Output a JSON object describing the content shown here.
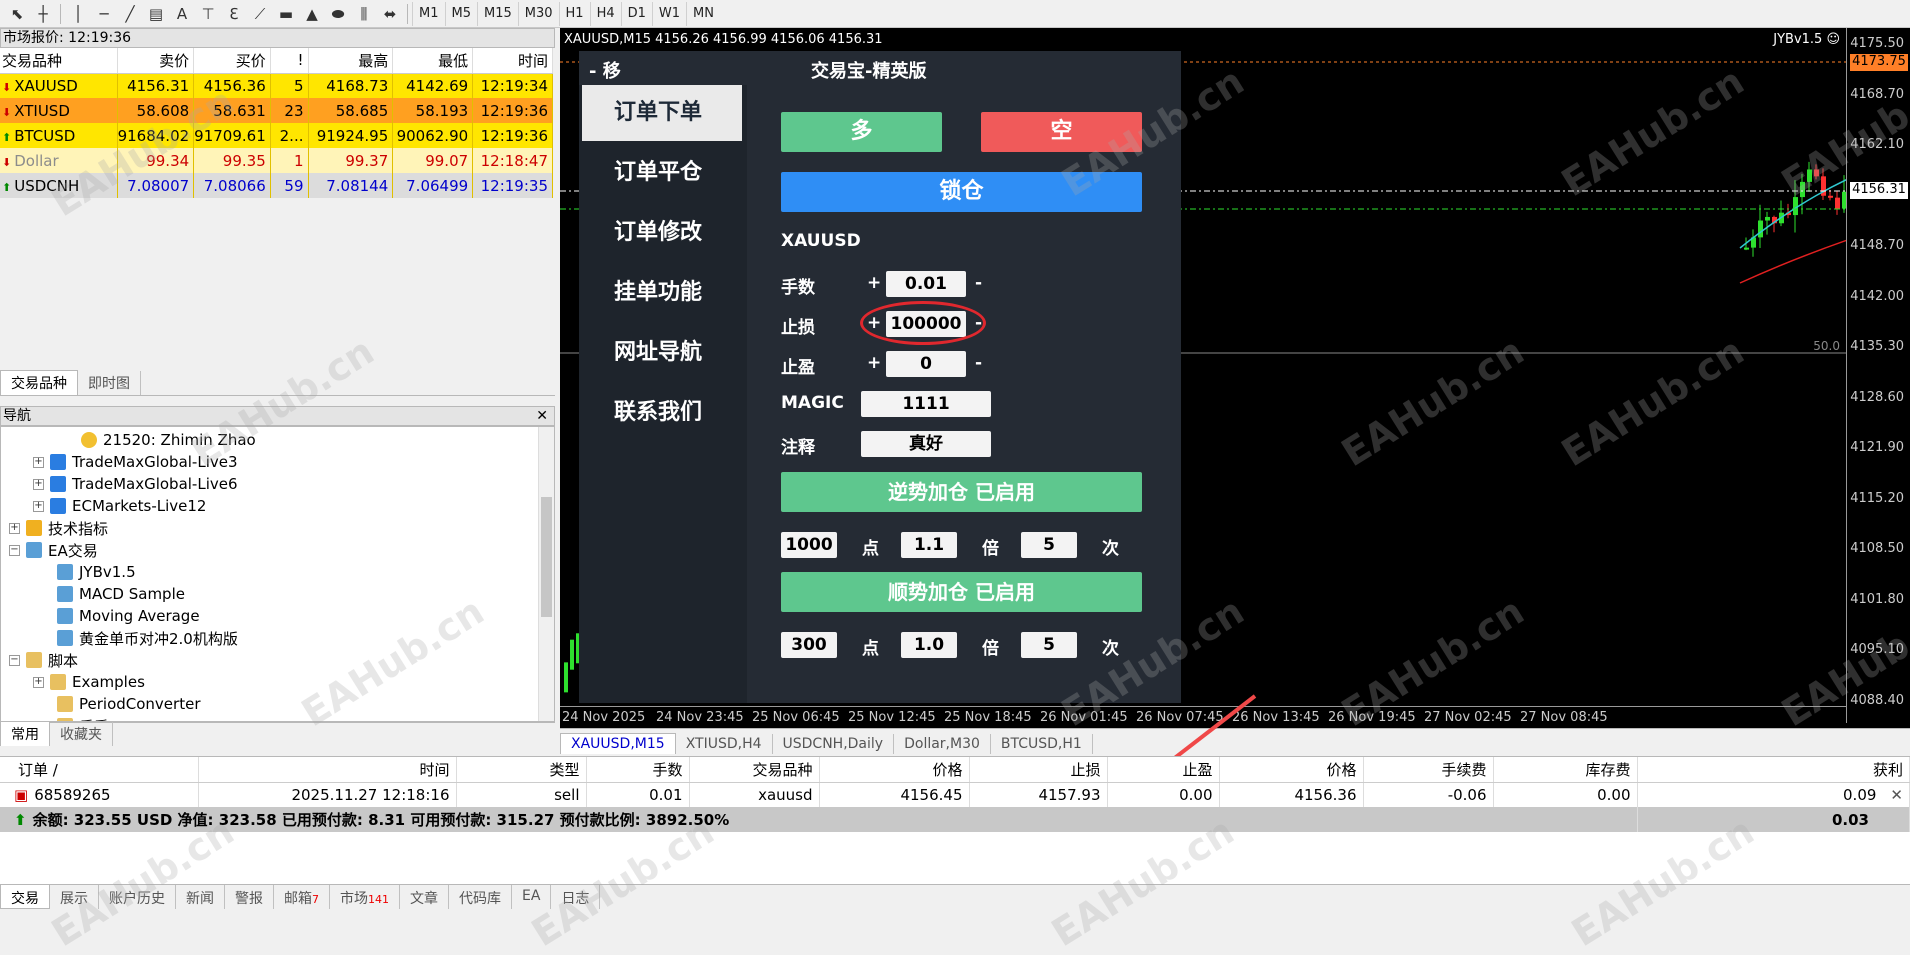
{
  "toolbar": {
    "timeframes": [
      "M1",
      "M5",
      "M15",
      "M30",
      "H1",
      "H4",
      "D1",
      "W1",
      "MN"
    ]
  },
  "market_watch": {
    "title": "市场报价: 12:19:36",
    "columns": [
      "交易品种",
      "卖价",
      "买价",
      "!",
      "最高",
      "最低",
      "时间"
    ],
    "rows": [
      {
        "symbol": "XAUUSD",
        "bid": "4156.31",
        "ask": "4156.36",
        "spread": "5",
        "high": "4168.73",
        "low": "4142.69",
        "time": "12:19:34",
        "bg": "#ffe600",
        "trend": "down"
      },
      {
        "symbol": "XTIUSD",
        "bid": "58.608",
        "ask": "58.631",
        "spread": "23",
        "high": "58.685",
        "low": "58.193",
        "time": "12:19:36",
        "bg": "#ffa020",
        "trend": "down"
      },
      {
        "symbol": "BTCUSD",
        "bid": "91684.02",
        "ask": "91709.61",
        "spread": "2...",
        "high": "91924.95",
        "low": "90062.90",
        "time": "12:19:36",
        "bg": "#ffe600",
        "trend": "up"
      },
      {
        "symbol": "Dollar",
        "bid": "99.34",
        "ask": "99.35",
        "spread": "1",
        "high": "99.37",
        "low": "99.07",
        "time": "12:18:47",
        "bg": "#fff4b8",
        "trend": "down"
      },
      {
        "symbol": "USDCNH",
        "bid": "7.08007",
        "ask": "7.08066",
        "spread": "59",
        "high": "7.08144",
        "low": "7.06499",
        "time": "12:19:35",
        "bg": "#dcdcdc",
        "trend": "up"
      }
    ],
    "tabs": [
      "交易品种",
      "即时图"
    ]
  },
  "navigator": {
    "title": "导航",
    "items": [
      {
        "label": "21520: Zhimin Zhao"
      },
      {
        "label": "TradeMaxGlobal-Live3"
      },
      {
        "label": "TradeMaxGlobal-Live6"
      },
      {
        "label": "ECMarkets-Live12"
      },
      {
        "label": "技术指标"
      },
      {
        "label": "EA交易"
      },
      {
        "label": "JYBv1.5"
      },
      {
        "label": "MACD Sample"
      },
      {
        "label": "Moving Average"
      },
      {
        "label": "黄金单币对冲2.0机构版"
      },
      {
        "label": "脚本"
      },
      {
        "label": "Examples"
      },
      {
        "label": "PeriodConverter"
      },
      {
        "label": "反手"
      }
    ],
    "tabs": [
      "常用",
      "收藏夹"
    ]
  },
  "chart": {
    "header": "XAUUSD,M15  4156.26 4156.99 4156.06 4156.31",
    "ea_label": "JYBv1.5 ☺",
    "price_labels": [
      "4175.50",
      "4168.70",
      "4162.10",
      "4155.20",
      "4148.70",
      "4142.00",
      "4135.30",
      "4128.60",
      "4121.90",
      "4115.20",
      "4108.50",
      "4101.80",
      "4095.10",
      "4088.40"
    ],
    "current_price": "4156.31",
    "high_price": "4173.75",
    "indicator_level": "50.0",
    "time_labels": [
      "24 Nov 2025",
      "24 Nov 23:45",
      "25 Nov 06:45",
      "25 Nov 12:45",
      "25 Nov 18:45",
      "26 Nov 01:45",
      "26 Nov 07:45",
      "26 Nov 13:45",
      "26 Nov 19:45",
      "27 Nov 02:45",
      "27 Nov 08:45"
    ],
    "tabs": [
      "XAUUSD,M15",
      "XTIUSD,H4",
      "USDCNH,Daily",
      "Dollar,M30",
      "BTCUSD,H1"
    ],
    "watermark": "EAHub.cn"
  },
  "ea_panel": {
    "header_left": "-  移",
    "title": "交易宝-精英版",
    "menu": [
      "订单下单",
      "订单平仓",
      "订单修改",
      "挂单功能",
      "网址导航",
      "联系我们"
    ],
    "buy_label": "多",
    "sell_label": "空",
    "lock_label": "锁仓",
    "symbol": "XAUUSD",
    "lots_label": "手数",
    "lots_value": "0.01",
    "sl_label": "止损",
    "sl_value": "100000",
    "tp_label": "止盈",
    "tp_value": "0",
    "magic_label": "MAGIC",
    "magic_value": "1111",
    "comment_label": "注释",
    "comment_value": "真好",
    "plus": "+",
    "minus": "-",
    "counter_trend_label": "逆势加仓  已启用",
    "counter_points": "1000",
    "counter_mult": "1.1",
    "counter_times": "5",
    "trend_label": "顺势加仓  已启用",
    "trend_points": "300",
    "trend_mult": "1.0",
    "trend_times": "5",
    "unit_points": "点",
    "unit_mult": "倍",
    "unit_times": "次",
    "colors": {
      "buy": "#5ec78e",
      "sell": "#f05a5a",
      "lock": "#2f8ef5",
      "add": "#5ec78e",
      "circle": "#e0282e"
    }
  },
  "terminal": {
    "columns": [
      "订单 /",
      "时间",
      "类型",
      "手数",
      "交易品种",
      "价格",
      "止损",
      "止盈",
      "价格",
      "手续费",
      "库存费",
      "获利"
    ],
    "order": {
      "ticket": "68589265",
      "time": "2025.11.27 12:18:16",
      "type": "sell",
      "lots": "0.01",
      "symbol": "xauusd",
      "open_price": "4156.45",
      "sl": "4157.93",
      "tp": "0.00",
      "price": "4156.36",
      "commission": "-0.06",
      "swap": "0.00",
      "profit": "0.09"
    },
    "summary": "余额: 323.55 USD  净值: 323.58  已用预付款: 8.31  可用预付款: 315.27  预付款比例: 3892.50%",
    "summary_profit": "0.03",
    "tabs": [
      {
        "label": "交易"
      },
      {
        "label": "展示"
      },
      {
        "label": "账户历史"
      },
      {
        "label": "新闻"
      },
      {
        "label": "警报"
      },
      {
        "label": "邮箱",
        "count": "7"
      },
      {
        "label": "市场",
        "count": "141"
      },
      {
        "label": "文章"
      },
      {
        "label": "代码库"
      },
      {
        "label": "EA"
      },
      {
        "label": "日志"
      }
    ]
  }
}
